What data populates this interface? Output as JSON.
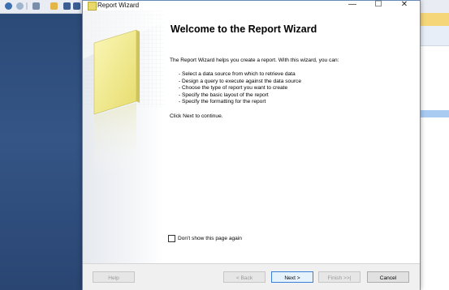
{
  "dialog": {
    "title": "Report Wizard",
    "heading": "Welcome to the Report Wizard",
    "intro": "The Report Wizard helps you create a report. With this wizard, you can:",
    "bullets": [
      "- Select a data source from which to retrieve data",
      "- Design a query to execute against the data source",
      "- Choose the type of report you want to create",
      "- Specify the basic layout of the report",
      "- Specify the formatting for the report"
    ],
    "click_next": "Click Next to continue.",
    "checkbox": {
      "label": "Don't show this page again",
      "checked": false
    },
    "buttons": {
      "help": "Help",
      "back": "< Back",
      "next": "Next >",
      "finish": "Finish >>|",
      "cancel": "Cancel"
    },
    "window_controls": {
      "minimize": "—",
      "maximize": "☐",
      "close": "✕"
    }
  },
  "icons": {
    "app": "report-wizard-icon",
    "side_graphic": "report-page-graphic"
  },
  "colors": {
    "ide_background": "#2f4a73",
    "page_graphic": "#f4ef9a",
    "primary_button_border": "#3c7fd9"
  }
}
